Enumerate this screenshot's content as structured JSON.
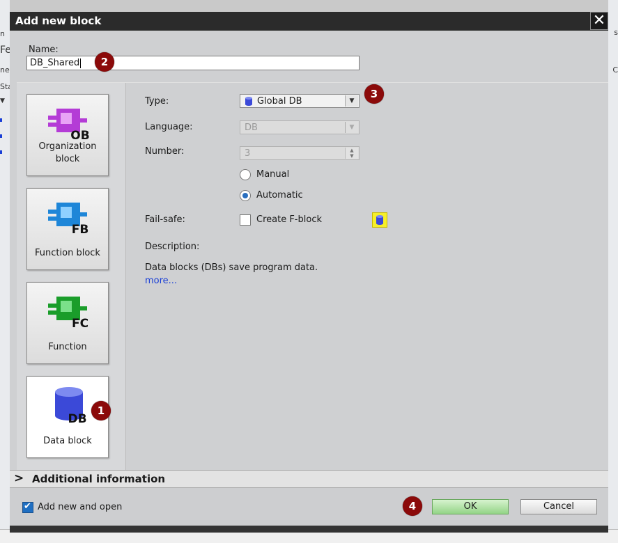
{
  "background": {
    "left_fragments": [
      "n",
      "Fe",
      "ne",
      "Sta",
      "▼"
    ],
    "right_fragments": [
      "s",
      "C"
    ]
  },
  "dialog": {
    "title": "Add new block",
    "close_label": "✕",
    "name_label": "Name:",
    "name_value": "DB_Shared",
    "block_types": [
      {
        "label": "Organization block",
        "code": "OB",
        "color": "#b43cd6"
      },
      {
        "label": "Function block",
        "code": "FB",
        "color": "#1e86d8"
      },
      {
        "label": "Function",
        "code": "FC",
        "color": "#1a9d2a"
      },
      {
        "label": "Data block",
        "code": "DB",
        "color": "#3b49d8",
        "selected": true
      }
    ],
    "fields": {
      "type_label": "Type:",
      "type_value": "Global DB",
      "language_label": "Language:",
      "language_value": "DB",
      "number_label": "Number:",
      "number_value": "3",
      "radio_manual": "Manual",
      "radio_automatic": "Automatic",
      "failsafe_label": "Fail-safe:",
      "create_fblock": "Create F-block",
      "description_label": "Description:",
      "description_text": "Data blocks (DBs) save program data.",
      "more_link": "more..."
    },
    "additional_information": "Additional information",
    "add_new_and_open": "Add new and open",
    "ok_label": "OK",
    "cancel_label": "Cancel"
  },
  "annotations": [
    "1",
    "2",
    "3",
    "4"
  ]
}
